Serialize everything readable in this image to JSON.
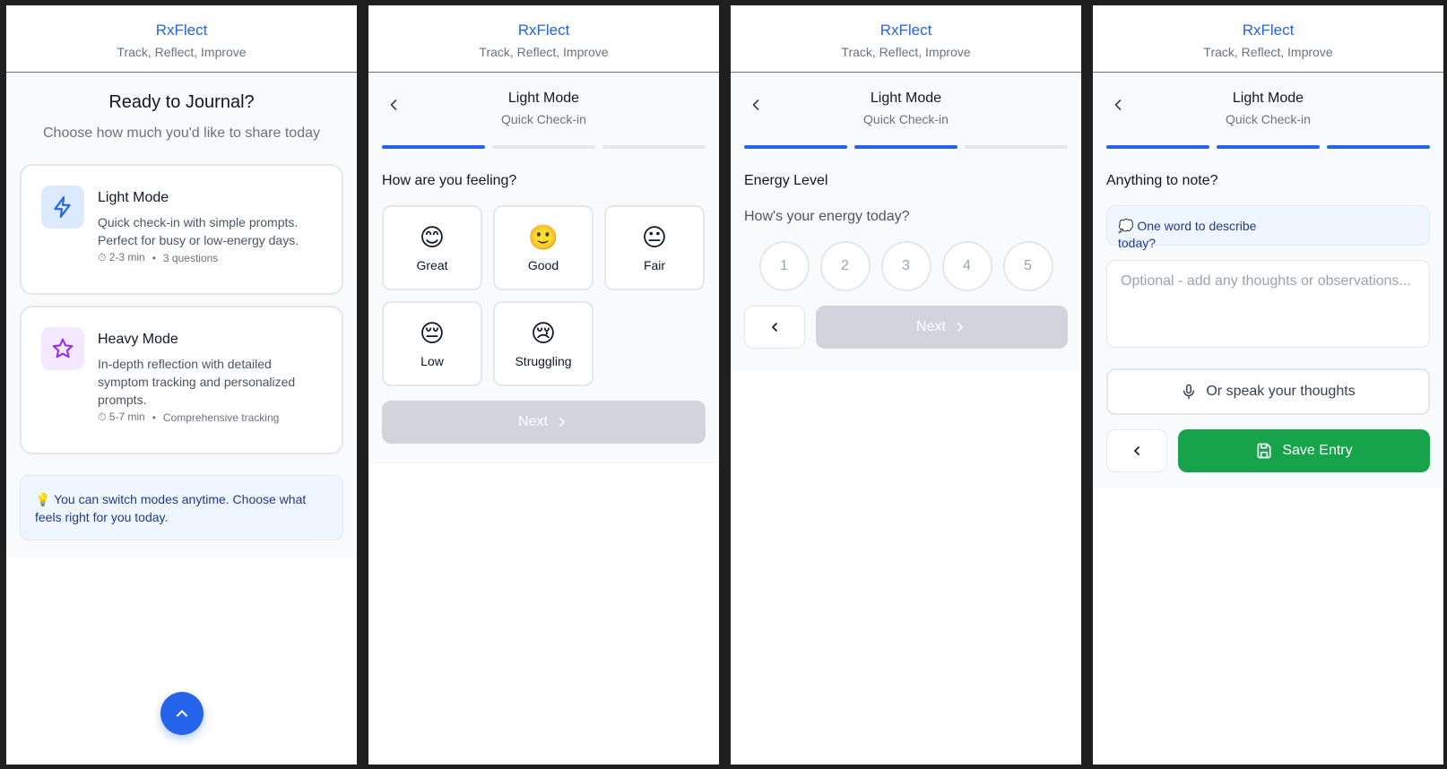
{
  "colors": {
    "accent": "#2563eb",
    "save": "#16a34a",
    "disabled": "#d1d5db"
  },
  "app": {
    "title": "RxFlect",
    "subtitle": "Track, Reflect, Improve"
  },
  "home": {
    "heading": "Ready to Journal?",
    "lede": "Choose how much you'd like to share today",
    "light": {
      "icon": "lightning-icon",
      "title": "Light Mode",
      "desc": "Quick check-in with simple prompts. Perfect for busy or low-energy days.",
      "time": "⏱ 2-3 min",
      "extra": "3 questions"
    },
    "heavy": {
      "icon": "star-icon",
      "title": "Heavy Mode",
      "desc": "In-depth reflection with detailed symptom tracking and personalized prompts.",
      "time": "⏱ 5-7 min",
      "extra": "Comprehensive tracking"
    },
    "dot": "•",
    "tip": "💡 You can switch modes anytime. Choose what feels right for you today."
  },
  "flow": {
    "title": "Light Mode",
    "subtitle": "Quick Check-in",
    "next_label": "Next"
  },
  "step1": {
    "question": "How are you feeling?",
    "moods": [
      {
        "emoji": "😊",
        "label": "Great"
      },
      {
        "emoji": "🙂",
        "label": "Good"
      },
      {
        "emoji": "😐",
        "label": "Fair"
      },
      {
        "emoji": "😔",
        "label": "Low"
      },
      {
        "emoji": "😢",
        "label": "Struggling"
      }
    ]
  },
  "step2": {
    "title": "Energy Level",
    "question": "How's your energy today?",
    "scale": [
      "1",
      "2",
      "3",
      "4",
      "5"
    ]
  },
  "step3": {
    "title": "Anything to note?",
    "prompt": "💭 One word to describe today?",
    "notes_placeholder": "Optional - add any thoughts or observations...",
    "speak_label": "Or speak your thoughts",
    "save_label": "Save Entry"
  }
}
